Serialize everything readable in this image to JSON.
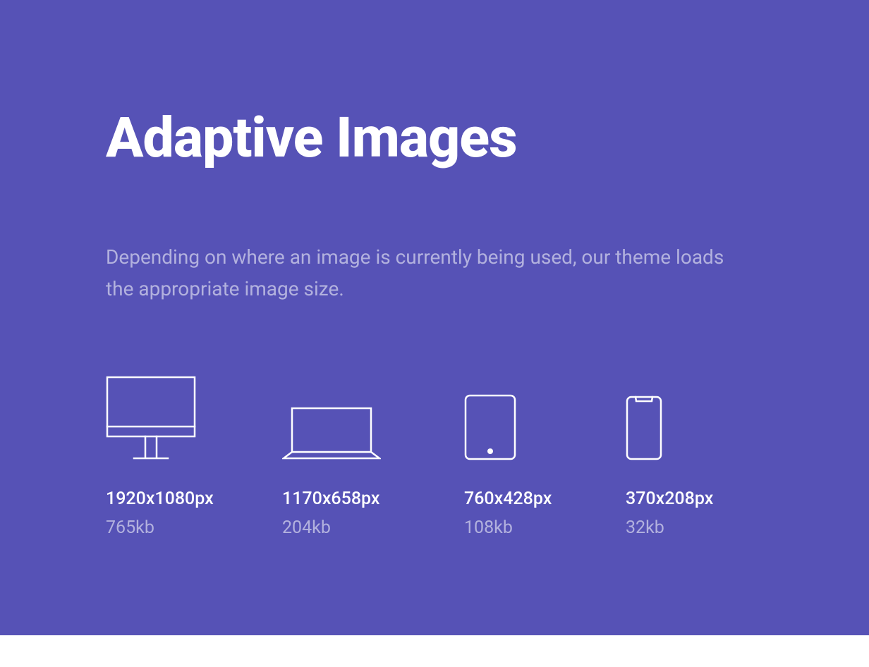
{
  "title": "Adaptive Images",
  "subtitle": "Depending on where an image is currently being used, our theme loads the appropriate image size.",
  "devices": [
    {
      "resolution": "1920x1080px",
      "filesize": "765kb"
    },
    {
      "resolution": "1170x658px",
      "filesize": "204kb"
    },
    {
      "resolution": "760x428px",
      "filesize": "108kb"
    },
    {
      "resolution": "370x208px",
      "filesize": "32kb"
    }
  ]
}
